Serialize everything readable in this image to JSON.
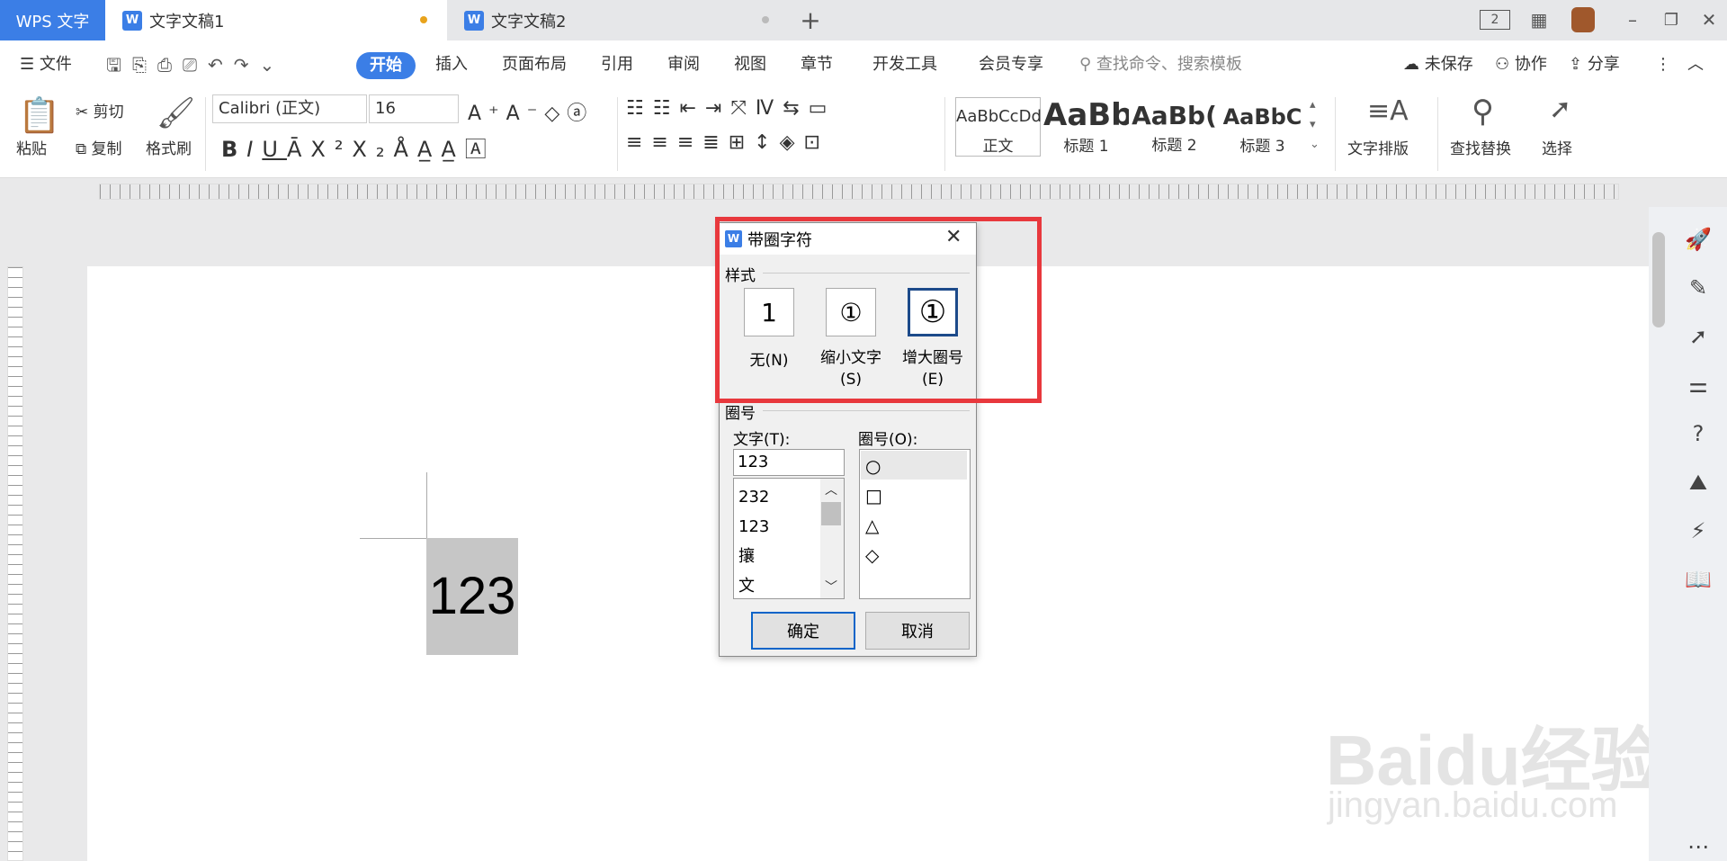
{
  "titlebar": {
    "app_name": "WPS 文字",
    "tabs": [
      {
        "label": "文字文稿1",
        "dot_color": "#e8a31c"
      },
      {
        "label": "文字文稿2",
        "dot_color": "#bbbbbb"
      }
    ],
    "new_tab": "+",
    "doc_icon_letter": "W",
    "badge_count": "2"
  },
  "menubar": {
    "file": "文件",
    "tabs": [
      "开始",
      "插入",
      "页面布局",
      "引用",
      "审阅",
      "视图",
      "章节",
      "开发工具",
      "会员专享"
    ],
    "search_placeholder": "查找命令、搜索模板",
    "unsaved": "未保存",
    "collab": "协作",
    "share": "分享"
  },
  "ribbon": {
    "paste": "粘贴",
    "cut": "剪切",
    "copy": "复制",
    "format_painter": "格式刷",
    "font_name": "Calibri (正文)",
    "font_size": "16",
    "styles": [
      {
        "preview": "AaBbCcDd",
        "label": "正文"
      },
      {
        "preview": "AaBb",
        "label": "标题 1"
      },
      {
        "preview": "AaBb(",
        "label": "标题 2"
      },
      {
        "preview": "AaBbC",
        "label": "标题 3"
      }
    ],
    "text_layout": "文字排版",
    "find_replace": "查找替换",
    "select": "选择"
  },
  "document": {
    "selected_text": "123"
  },
  "dialog": {
    "title": "带圈字符",
    "style_label": "样式",
    "options": [
      {
        "label": "无(N)",
        "glyph": "1"
      },
      {
        "label": "缩小文字(S)",
        "glyph": "①"
      },
      {
        "label": "增大圈号(E)",
        "glyph": "①"
      }
    ],
    "circle_section": "圈号",
    "text_label": "文字(T):",
    "text_value": "123",
    "text_list": [
      "232",
      "123",
      "攘",
      "文"
    ],
    "circle_label": "圈号(O):",
    "circle_list": [
      "○",
      "□",
      "△",
      "◇"
    ],
    "ok": "确定",
    "cancel": "取消"
  },
  "watermark": {
    "line1": "Bai",
    "line2": "du",
    "line3": "经验",
    "url": "jingyan.baidu.com"
  },
  "colors": {
    "accent": "#3b7ee6",
    "highlight": "#e8383d"
  }
}
